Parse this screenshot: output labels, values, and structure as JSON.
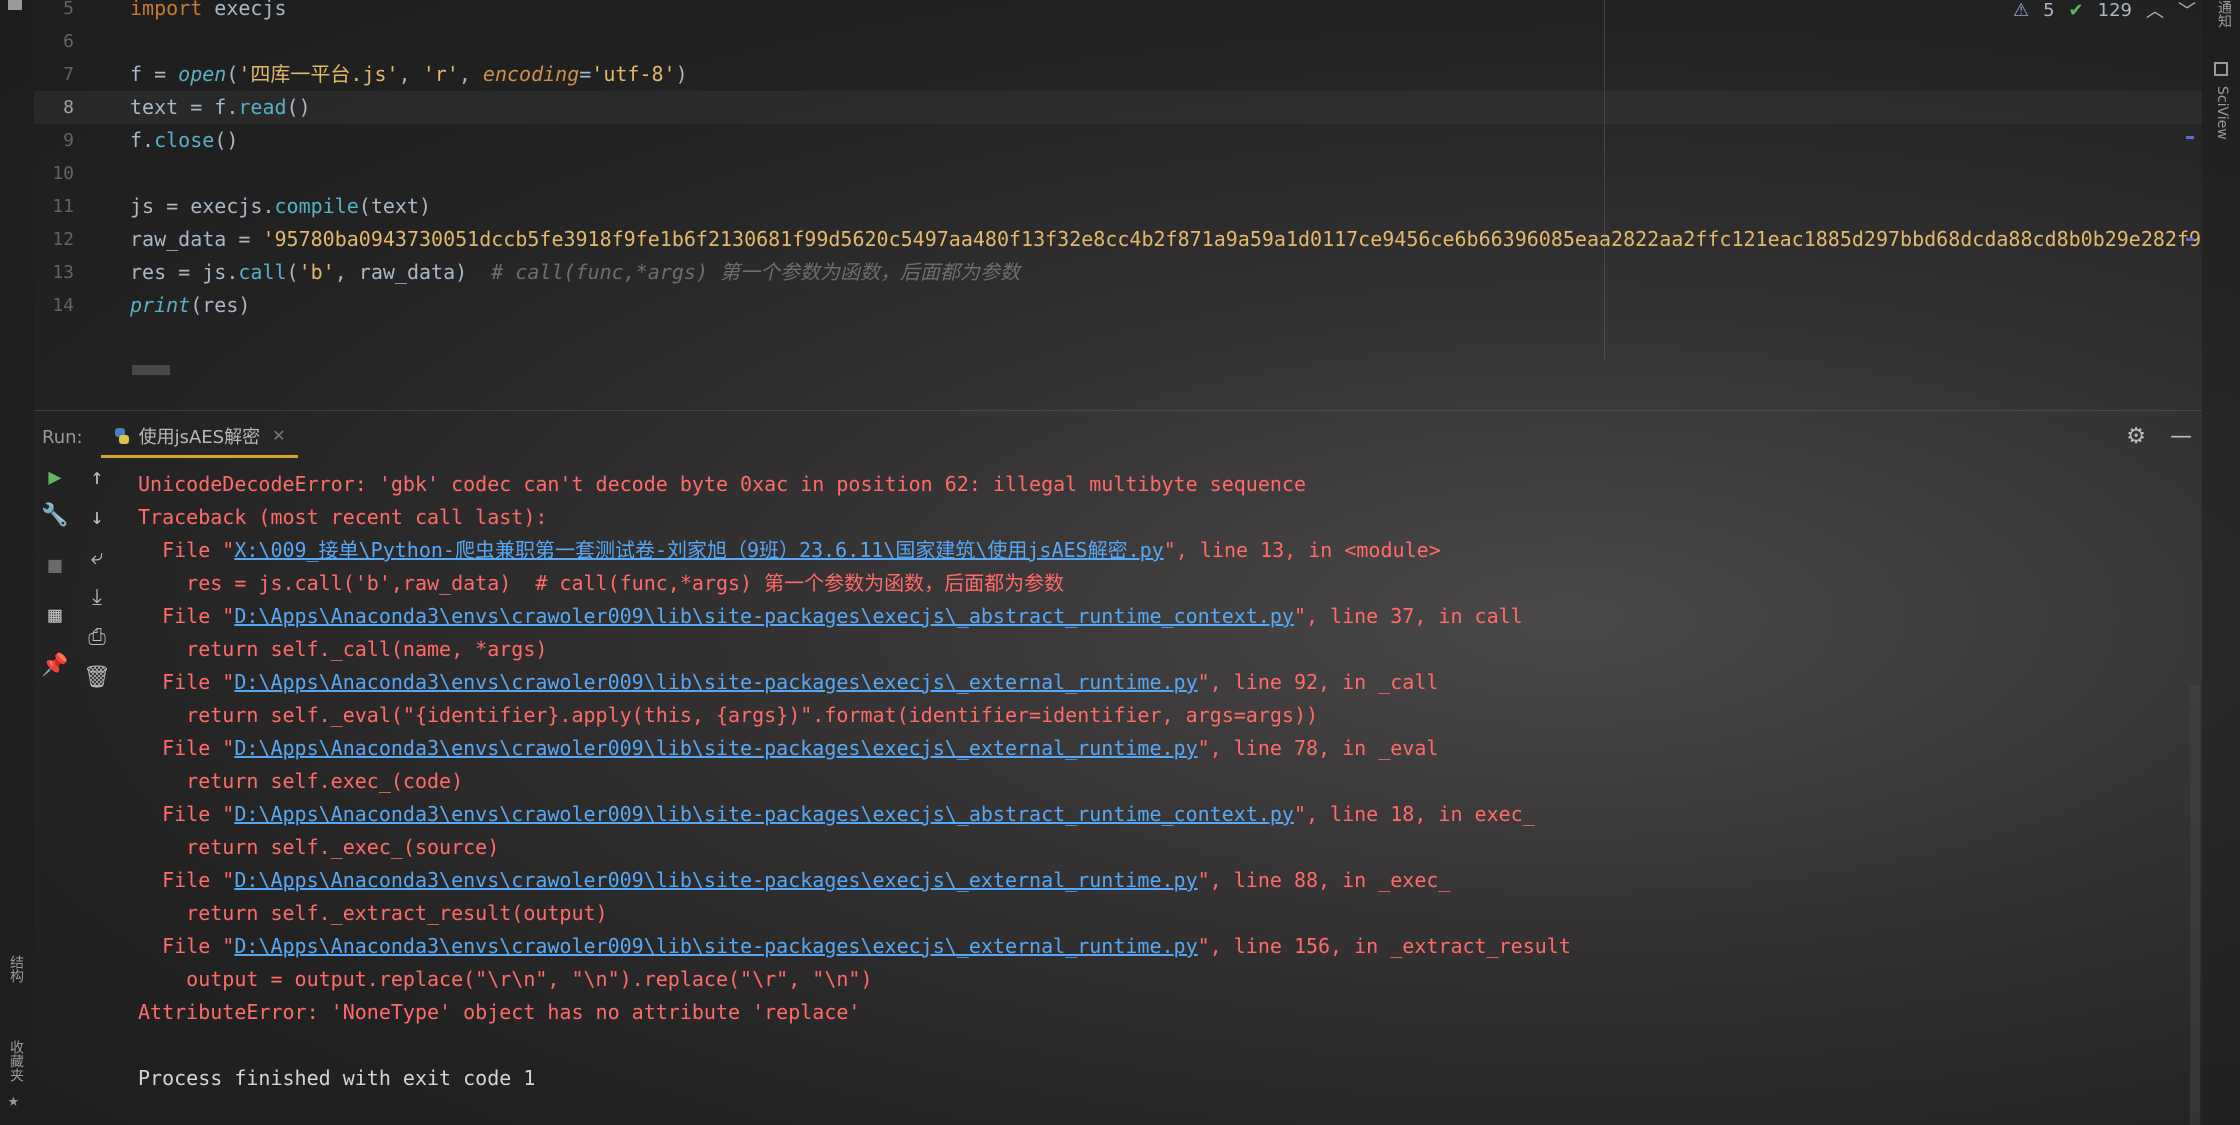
{
  "editor": {
    "lines": [
      {
        "num": "5",
        "tokens": [
          [
            "kw",
            "import"
          ],
          [
            "plain",
            " execjs"
          ]
        ]
      },
      {
        "num": "6",
        "tokens": []
      },
      {
        "num": "7",
        "tokens": [
          [
            "plain",
            "f = "
          ],
          [
            "fn",
            "open"
          ],
          [
            "plain",
            "("
          ],
          [
            "str",
            "'四库一平台.js'"
          ],
          [
            "plain",
            ", "
          ],
          [
            "str",
            "'r'"
          ],
          [
            "plain",
            ", "
          ],
          [
            "param",
            "encoding"
          ],
          [
            "plain",
            "="
          ],
          [
            "str",
            "'utf-8'"
          ],
          [
            "plain",
            ")"
          ]
        ]
      },
      {
        "num": "8",
        "tokens": [
          [
            "plain",
            "text = f."
          ],
          [
            "meth",
            "read"
          ],
          [
            "plain",
            "()"
          ]
        ]
      },
      {
        "num": "9",
        "tokens": [
          [
            "plain",
            "f."
          ],
          [
            "meth",
            "close"
          ],
          [
            "plain",
            "()"
          ]
        ]
      },
      {
        "num": "10",
        "tokens": []
      },
      {
        "num": "11",
        "tokens": [
          [
            "plain",
            "js = execjs."
          ],
          [
            "meth",
            "compile"
          ],
          [
            "plain",
            "(text)"
          ]
        ]
      },
      {
        "num": "12",
        "tokens": [
          [
            "plain",
            "raw_data = "
          ],
          [
            "str",
            "'95780ba0943730051dccb5fe3918f9fe1b6f2130681f99d5620c5497aa480f13f32e8cc4b2f871a9a59a1d0117ce9456ce6b66396085eaa2822aa2ffc121eac1885d297bbd68dcda88cd8b0b29e282f9"
          ]
        ]
      },
      {
        "num": "13",
        "tokens": [
          [
            "plain",
            "res = js."
          ],
          [
            "meth",
            "call"
          ],
          [
            "plain",
            "("
          ],
          [
            "str",
            "'b'"
          ],
          [
            "plain",
            ", raw_data)  "
          ],
          [
            "comment",
            "# call(func,*args) 第一个参数为函数，后面都为参数"
          ]
        ]
      },
      {
        "num": "14",
        "tokens": [
          [
            "fn",
            "print"
          ],
          [
            "plain",
            "(res)"
          ]
        ]
      }
    ],
    "status": {
      "warnings": "5",
      "checks": "129"
    }
  },
  "run": {
    "label": "Run:",
    "tab_name": "使用jsAES解密"
  },
  "console": {
    "lines": [
      {
        "cls": "err",
        "parts": [
          [
            "t",
            "UnicodeDecodeError: 'gbk' codec can't decode byte 0xac in position 62: illegal multibyte sequence"
          ]
        ]
      },
      {
        "cls": "err",
        "parts": [
          [
            "t",
            "Traceback (most recent call last):"
          ]
        ]
      },
      {
        "cls": "err",
        "parts": [
          [
            "t",
            "  File \""
          ],
          [
            "l",
            "X:\\009_接单\\Python-爬虫兼职第一套测试卷-刘家旭（9班）23.6.11\\国家建筑\\使用jsAES解密.py"
          ],
          [
            "t",
            "\", line 13, in <module>"
          ]
        ]
      },
      {
        "cls": "err",
        "parts": [
          [
            "t",
            "    res = js.call('b',raw_data)  # call(func,*args) 第一个参数为函数，后面都为参数"
          ]
        ]
      },
      {
        "cls": "err",
        "parts": [
          [
            "t",
            "  File \""
          ],
          [
            "l",
            "D:\\Apps\\Anaconda3\\envs\\crawoler009\\lib\\site-packages\\execjs\\_abstract_runtime_context.py"
          ],
          [
            "t",
            "\", line 37, in call"
          ]
        ]
      },
      {
        "cls": "err",
        "parts": [
          [
            "t",
            "    return self._call(name, *args)"
          ]
        ]
      },
      {
        "cls": "err",
        "parts": [
          [
            "t",
            "  File \""
          ],
          [
            "l",
            "D:\\Apps\\Anaconda3\\envs\\crawoler009\\lib\\site-packages\\execjs\\_external_runtime.py"
          ],
          [
            "t",
            "\", line 92, in _call"
          ]
        ]
      },
      {
        "cls": "err",
        "parts": [
          [
            "t",
            "    return self._eval(\"{identifier}.apply(this, {args})\".format(identifier=identifier, args=args))"
          ]
        ]
      },
      {
        "cls": "err",
        "parts": [
          [
            "t",
            "  File \""
          ],
          [
            "l",
            "D:\\Apps\\Anaconda3\\envs\\crawoler009\\lib\\site-packages\\execjs\\_external_runtime.py"
          ],
          [
            "t",
            "\", line 78, in _eval"
          ]
        ]
      },
      {
        "cls": "err",
        "parts": [
          [
            "t",
            "    return self.exec_(code)"
          ]
        ]
      },
      {
        "cls": "err",
        "parts": [
          [
            "t",
            "  File \""
          ],
          [
            "l",
            "D:\\Apps\\Anaconda3\\envs\\crawoler009\\lib\\site-packages\\execjs\\_abstract_runtime_context.py"
          ],
          [
            "t",
            "\", line 18, in exec_"
          ]
        ]
      },
      {
        "cls": "err",
        "parts": [
          [
            "t",
            "    return self._exec_(source)"
          ]
        ]
      },
      {
        "cls": "err",
        "parts": [
          [
            "t",
            "  File \""
          ],
          [
            "l",
            "D:\\Apps\\Anaconda3\\envs\\crawoler009\\lib\\site-packages\\execjs\\_external_runtime.py"
          ],
          [
            "t",
            "\", line 88, in _exec_"
          ]
        ]
      },
      {
        "cls": "err",
        "parts": [
          [
            "t",
            "    return self._extract_result(output)"
          ]
        ]
      },
      {
        "cls": "err",
        "parts": [
          [
            "t",
            "  File \""
          ],
          [
            "l",
            "D:\\Apps\\Anaconda3\\envs\\crawoler009\\lib\\site-packages\\execjs\\_external_runtime.py"
          ],
          [
            "t",
            "\", line 156, in _extract_result"
          ]
        ]
      },
      {
        "cls": "err",
        "parts": [
          [
            "t",
            "    output = output.replace(\"\\r\\n\", \"\\n\").replace(\"\\r\", \"\\n\")"
          ]
        ]
      },
      {
        "cls": "err",
        "parts": [
          [
            "t",
            "AttributeError: 'NoneType' object has no attribute 'replace'"
          ]
        ]
      },
      {
        "cls": "out",
        "parts": []
      },
      {
        "cls": "out",
        "parts": [
          [
            "t",
            "Process finished with exit code 1"
          ]
        ]
      }
    ]
  },
  "side": {
    "right_top": "通知",
    "right_sciview": "SciView",
    "left_structure": "结构",
    "left_favorites": "收藏夹"
  },
  "colors": {
    "accent": "#d4a72c",
    "error": "#ff6b68",
    "link": "#56a8f5"
  }
}
